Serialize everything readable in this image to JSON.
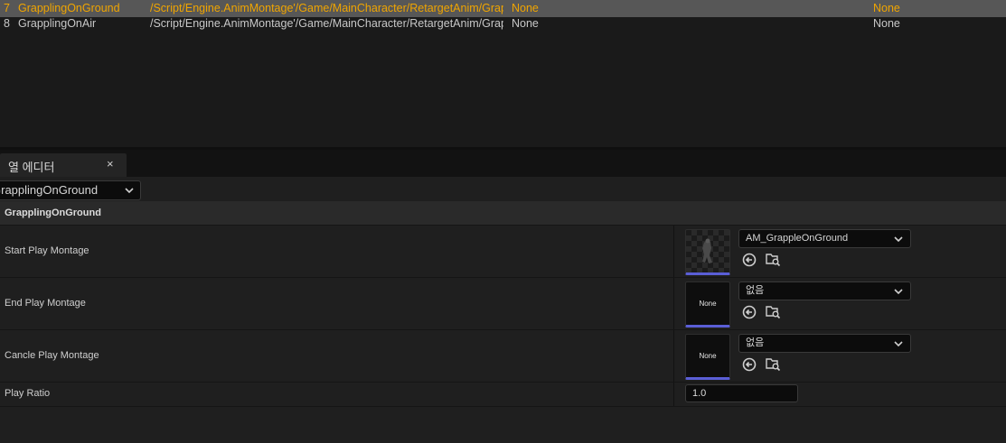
{
  "table": {
    "rows": [
      {
        "index": "7",
        "name": "GrapplingOnGround",
        "path": "/Script/Engine.AnimMontage'/Game/MainCharacter/RetargetAnim/Grapp",
        "col3": "None",
        "col4": "None",
        "selected": true
      },
      {
        "index": "8",
        "name": "GrapplingOnAir",
        "path": "/Script/Engine.AnimMontage'/Game/MainCharacter/RetargetAnim/Grapp",
        "col3": "None",
        "col4": "None",
        "selected": false
      }
    ]
  },
  "editor_tab": {
    "label": "열 에디터",
    "close": "×"
  },
  "row_selector": {
    "value": "GrapplingOnGround"
  },
  "category": {
    "title": "GrapplingOnGround"
  },
  "properties": [
    {
      "label": "Start Play Montage",
      "asset": "AM_GrappleOnGround",
      "thumbnail": "",
      "has_preview": true
    },
    {
      "label": "End Play Montage",
      "asset": "없음",
      "thumbnail": "None",
      "has_preview": false
    },
    {
      "label": "Cancle Play Montage",
      "asset": "없음",
      "thumbnail": "None",
      "has_preview": false
    }
  ],
  "play_ratio": {
    "label": "Play Ratio",
    "value": "1.0"
  },
  "colors": {
    "selected_text": "#f0a500",
    "thumbnail_accent": "#5a5ed6",
    "background": "#1a1a1a"
  },
  "icons": [
    "chevron-down-icon",
    "use-selected-asset-icon",
    "browse-to-asset-icon",
    "close-icon"
  ]
}
